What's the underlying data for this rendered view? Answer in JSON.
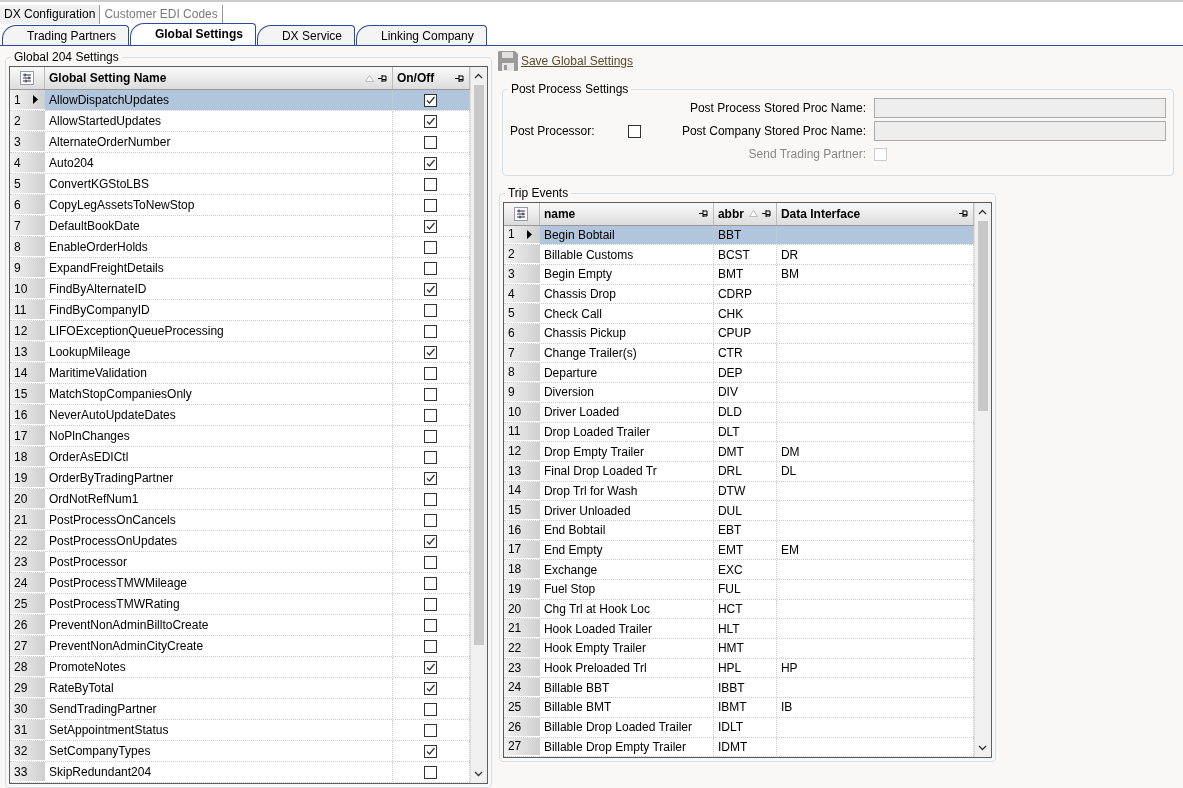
{
  "top_tabs": [
    {
      "label": "DX Configuration",
      "selected": true
    },
    {
      "label": "Customer EDI Codes",
      "selected": false
    }
  ],
  "tabs": [
    {
      "label": "Trading Partners",
      "selected": false
    },
    {
      "label": "Global Settings",
      "selected": true
    },
    {
      "label": "DX Service",
      "selected": false
    },
    {
      "label": "Linking Company",
      "selected": false
    }
  ],
  "global_settings": {
    "title": "Global 204 Settings",
    "columns": [
      {
        "label": "Global Setting Name",
        "sorted": true
      },
      {
        "label": "On/Off",
        "sorted": false
      }
    ],
    "rows": [
      {
        "number": "1",
        "name": "AllowDispatchUpdates",
        "on": true,
        "selected": true
      },
      {
        "number": "2",
        "name": "AllowStartedUpdates",
        "on": true,
        "selected": false
      },
      {
        "number": "3",
        "name": "AlternateOrderNumber",
        "on": false,
        "selected": false
      },
      {
        "number": "4",
        "name": "Auto204",
        "on": true,
        "selected": false
      },
      {
        "number": "5",
        "name": "ConvertKGStoLBS",
        "on": false,
        "selected": false
      },
      {
        "number": "6",
        "name": "CopyLegAssetsToNewStop",
        "on": false,
        "selected": false
      },
      {
        "number": "7",
        "name": "DefaultBookDate",
        "on": true,
        "selected": false
      },
      {
        "number": "8",
        "name": "EnableOrderHolds",
        "on": false,
        "selected": false
      },
      {
        "number": "9",
        "name": "ExpandFreightDetails",
        "on": false,
        "selected": false
      },
      {
        "number": "10",
        "name": "FindByAlternateID",
        "on": true,
        "selected": false
      },
      {
        "number": "11",
        "name": "FindByCompanyID",
        "on": false,
        "selected": false
      },
      {
        "number": "12",
        "name": "LIFOExceptionQueueProcessing",
        "on": false,
        "selected": false
      },
      {
        "number": "13",
        "name": "LookupMileage",
        "on": true,
        "selected": false
      },
      {
        "number": "14",
        "name": "MaritimeValidation",
        "on": false,
        "selected": false
      },
      {
        "number": "15",
        "name": "MatchStopCompaniesOnly",
        "on": false,
        "selected": false
      },
      {
        "number": "16",
        "name": "NeverAutoUpdateDates",
        "on": false,
        "selected": false
      },
      {
        "number": "17",
        "name": "NoPlnChanges",
        "on": false,
        "selected": false
      },
      {
        "number": "18",
        "name": "OrderAsEDICtl",
        "on": false,
        "selected": false
      },
      {
        "number": "19",
        "name": "OrderByTradingPartner",
        "on": true,
        "selected": false
      },
      {
        "number": "20",
        "name": "OrdNotRefNum1",
        "on": false,
        "selected": false
      },
      {
        "number": "21",
        "name": "PostProcessOnCancels",
        "on": false,
        "selected": false
      },
      {
        "number": "22",
        "name": "PostProcessOnUpdates",
        "on": true,
        "selected": false
      },
      {
        "number": "23",
        "name": "PostProcessor",
        "on": false,
        "selected": false
      },
      {
        "number": "24",
        "name": "PostProcessTMWMileage",
        "on": false,
        "selected": false
      },
      {
        "number": "25",
        "name": "PostProcessTMWRating",
        "on": false,
        "selected": false
      },
      {
        "number": "26",
        "name": "PreventNonAdminBilltoCreate",
        "on": false,
        "selected": false
      },
      {
        "number": "27",
        "name": "PreventNonAdminCityCreate",
        "on": false,
        "selected": false
      },
      {
        "number": "28",
        "name": "PromoteNotes",
        "on": true,
        "selected": false
      },
      {
        "number": "29",
        "name": "RateByTotal",
        "on": true,
        "selected": false
      },
      {
        "number": "30",
        "name": "SendTradingPartner",
        "on": false,
        "selected": false
      },
      {
        "number": "31",
        "name": "SetAppointmentStatus",
        "on": false,
        "selected": false
      },
      {
        "number": "32",
        "name": "SetCompanyTypes",
        "on": true,
        "selected": false
      },
      {
        "number": "33",
        "name": "SkipRedundant204",
        "on": false,
        "selected": false
      }
    ]
  },
  "save_link": "Save Global Settings",
  "post_process": {
    "title": "Post Process Settings",
    "post_processor": {
      "label": "Post Processor:",
      "checked": false
    },
    "fields": [
      {
        "label": "Post Process Stored Proc Name:"
      },
      {
        "label": "Post Company Stored Proc Name:"
      }
    ],
    "send_trading_partner": {
      "label": "Send Trading Partner:",
      "checked": false,
      "disabled": true
    }
  },
  "trip_events": {
    "title": "Trip Events",
    "columns": [
      {
        "label": "name",
        "sorted": false
      },
      {
        "label": "abbr",
        "sorted": true
      },
      {
        "label": "Data Interface",
        "sorted": false
      }
    ],
    "rows": [
      {
        "number": "1",
        "name": "Begin Bobtail",
        "abbr": "BBT",
        "selected": true
      },
      {
        "number": "2",
        "name": "Billable Customs",
        "abbr": "BCST",
        "data_interface": "DR",
        "selected": false
      },
      {
        "number": "3",
        "name": "Begin Empty",
        "abbr": "BMT",
        "data_interface": "BM",
        "selected": false
      },
      {
        "number": "4",
        "name": "Chassis Drop",
        "abbr": "CDRP",
        "selected": false
      },
      {
        "number": "5",
        "name": "Check Call",
        "abbr": "CHK",
        "selected": false
      },
      {
        "number": "6",
        "name": "Chassis Pickup",
        "abbr": "CPUP",
        "selected": false
      },
      {
        "number": "7",
        "name": "Change Trailer(s)",
        "abbr": "CTR",
        "selected": false
      },
      {
        "number": "8",
        "name": "Departure",
        "abbr": "DEP",
        "selected": false
      },
      {
        "number": "9",
        "name": "Diversion",
        "abbr": "DIV",
        "selected": false
      },
      {
        "number": "10",
        "name": "Driver Loaded",
        "abbr": "DLD",
        "selected": false
      },
      {
        "number": "11",
        "name": "Drop Loaded Trailer",
        "abbr": "DLT",
        "selected": false
      },
      {
        "number": "12",
        "name": "Drop Empty Trailer",
        "abbr": "DMT",
        "data_interface": "DM",
        "selected": false
      },
      {
        "number": "13",
        "name": "Final Drop Loaded Tr",
        "abbr": "DRL",
        "data_interface": "DL",
        "selected": false
      },
      {
        "number": "14",
        "name": "Drop Trl for Wash",
        "abbr": "DTW",
        "selected": false
      },
      {
        "number": "15",
        "name": "Driver Unloaded",
        "abbr": "DUL",
        "selected": false
      },
      {
        "number": "16",
        "name": "End Bobtail",
        "abbr": "EBT",
        "selected": false
      },
      {
        "number": "17",
        "name": "End Empty",
        "abbr": "EMT",
        "data_interface": "EM",
        "selected": false
      },
      {
        "number": "18",
        "name": "Exchange",
        "abbr": "EXC",
        "selected": false
      },
      {
        "number": "19",
        "name": "Fuel Stop",
        "abbr": "FUL",
        "selected": false
      },
      {
        "number": "20",
        "name": "Chg Trl at Hook Loc",
        "abbr": "HCT",
        "selected": false
      },
      {
        "number": "21",
        "name": "Hook Loaded Trailer",
        "abbr": "HLT",
        "selected": false
      },
      {
        "number": "22",
        "name": "Hook Empty Trailer",
        "abbr": "HMT",
        "selected": false
      },
      {
        "number": "23",
        "name": "Hook Preloaded Trl",
        "abbr": "HPL",
        "data_interface": "HP",
        "selected": false
      },
      {
        "number": "24",
        "name": "Billable BBT",
        "abbr": "IBBT",
        "selected": false
      },
      {
        "number": "25",
        "name": "Billable BMT",
        "abbr": "IBMT",
        "data_interface": "IB",
        "selected": false
      },
      {
        "number": "26",
        "name": "Billable Drop Loaded Trailer",
        "abbr": "IDLT",
        "selected": false
      },
      {
        "number": "27",
        "name": "Billable Drop Empty Trailer",
        "abbr": "IDMT",
        "selected": false
      }
    ]
  }
}
